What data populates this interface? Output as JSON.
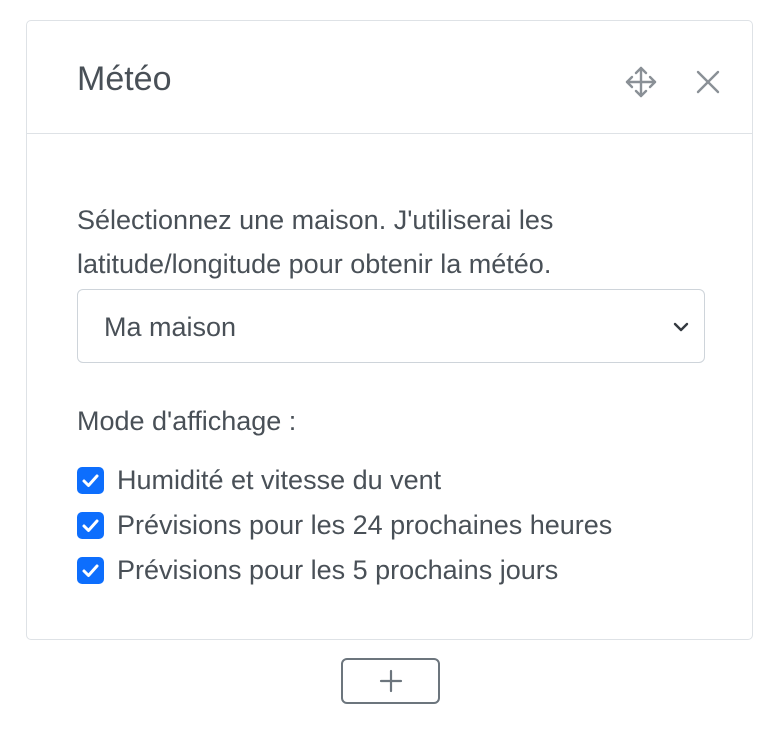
{
  "widget": {
    "title": "Météo",
    "header_icons": {
      "move": "move-icon",
      "close": "close-icon"
    },
    "description": "Sélectionnez une maison. J'utiliserai les latitude/longitude pour obtenir la météo.",
    "house_select": {
      "selected": "Ma maison",
      "icon": "chevron-down-icon"
    },
    "display_mode_label": "Mode d'affichage :",
    "options": [
      {
        "label": "Humidité et vitesse du vent",
        "checked": true
      },
      {
        "label": "Prévisions pour les 24 prochaines heures",
        "checked": true
      },
      {
        "label": "Prévisions pour les 5 prochains jours",
        "checked": true
      }
    ]
  },
  "add_button": {
    "icon": "plus-icon"
  },
  "colors": {
    "accent": "#0d6efd",
    "text": "#495057",
    "border": "#dee2e6",
    "icon": "#8a9096"
  }
}
